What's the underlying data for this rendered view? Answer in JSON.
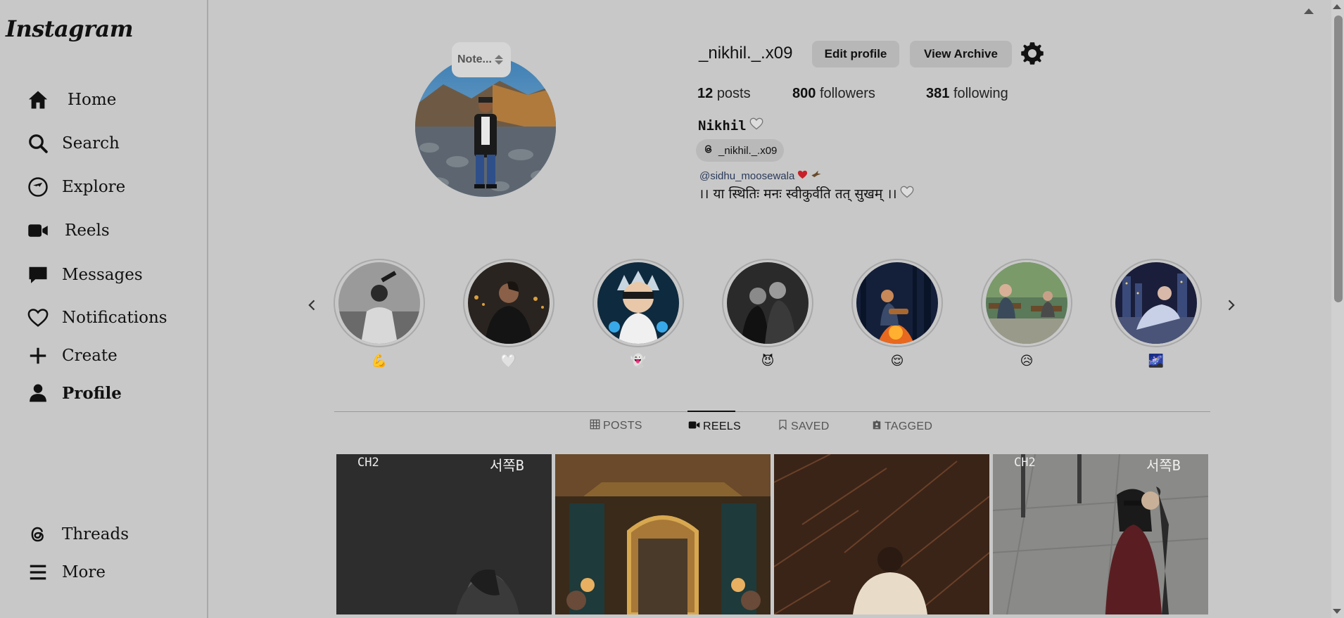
{
  "app": {
    "logo": "Instagram"
  },
  "sidebar": {
    "items": [
      {
        "label": "Home",
        "icon": "home-icon"
      },
      {
        "label": "Search",
        "icon": "search-icon"
      },
      {
        "label": "Explore",
        "icon": "compass-icon"
      },
      {
        "label": "Reels",
        "icon": "reels-icon"
      },
      {
        "label": "Messages",
        "icon": "message-icon"
      },
      {
        "label": "Notifications",
        "icon": "heart-icon"
      },
      {
        "label": "Create",
        "icon": "plus-icon"
      },
      {
        "label": "Profile",
        "icon": "user-icon"
      }
    ],
    "bottom": [
      {
        "label": "Threads",
        "icon": "threads-icon"
      },
      {
        "label": "More",
        "icon": "menu-icon"
      }
    ]
  },
  "profile": {
    "note_label": "Note...",
    "username": "_nikhil._.x09",
    "edit_button": "Edit profile",
    "archive_button": "View Archive",
    "stats": {
      "posts_count": "12",
      "posts_label": "posts",
      "followers_count": "800",
      "followers_label": "followers",
      "following_count": "381",
      "following_label": "following"
    },
    "full_name": "Nikhil",
    "threads_handle": "_nikhil._.x09",
    "mention": "@sidhu_moosewala",
    "bio": "।। या स्थितिः मनः स्वीकुर्वति तत् सुखम् ।।"
  },
  "highlights": [
    {
      "emoji": "💪"
    },
    {
      "emoji": "🤍"
    },
    {
      "emoji": "👻"
    },
    {
      "emoji": "😈"
    },
    {
      "emoji": "😌"
    },
    {
      "emoji": "😥"
    },
    {
      "emoji": "🌌"
    }
  ],
  "tabs": [
    {
      "label": "POSTS",
      "icon": "grid-icon"
    },
    {
      "label": "REELS",
      "icon": "video-icon",
      "active": true
    },
    {
      "label": "SAVED",
      "icon": "bookmark-icon"
    },
    {
      "label": "TAGGED",
      "icon": "tag-icon"
    }
  ],
  "grid": {
    "tile1_tl": "CH2",
    "tile1_tr": "서쪽B",
    "tile4_tl": "CH2",
    "tile4_tr": "서쪽B"
  },
  "colors": {
    "background": "#c8c8c8",
    "button": "#b7b7b7",
    "text": "#111111"
  }
}
